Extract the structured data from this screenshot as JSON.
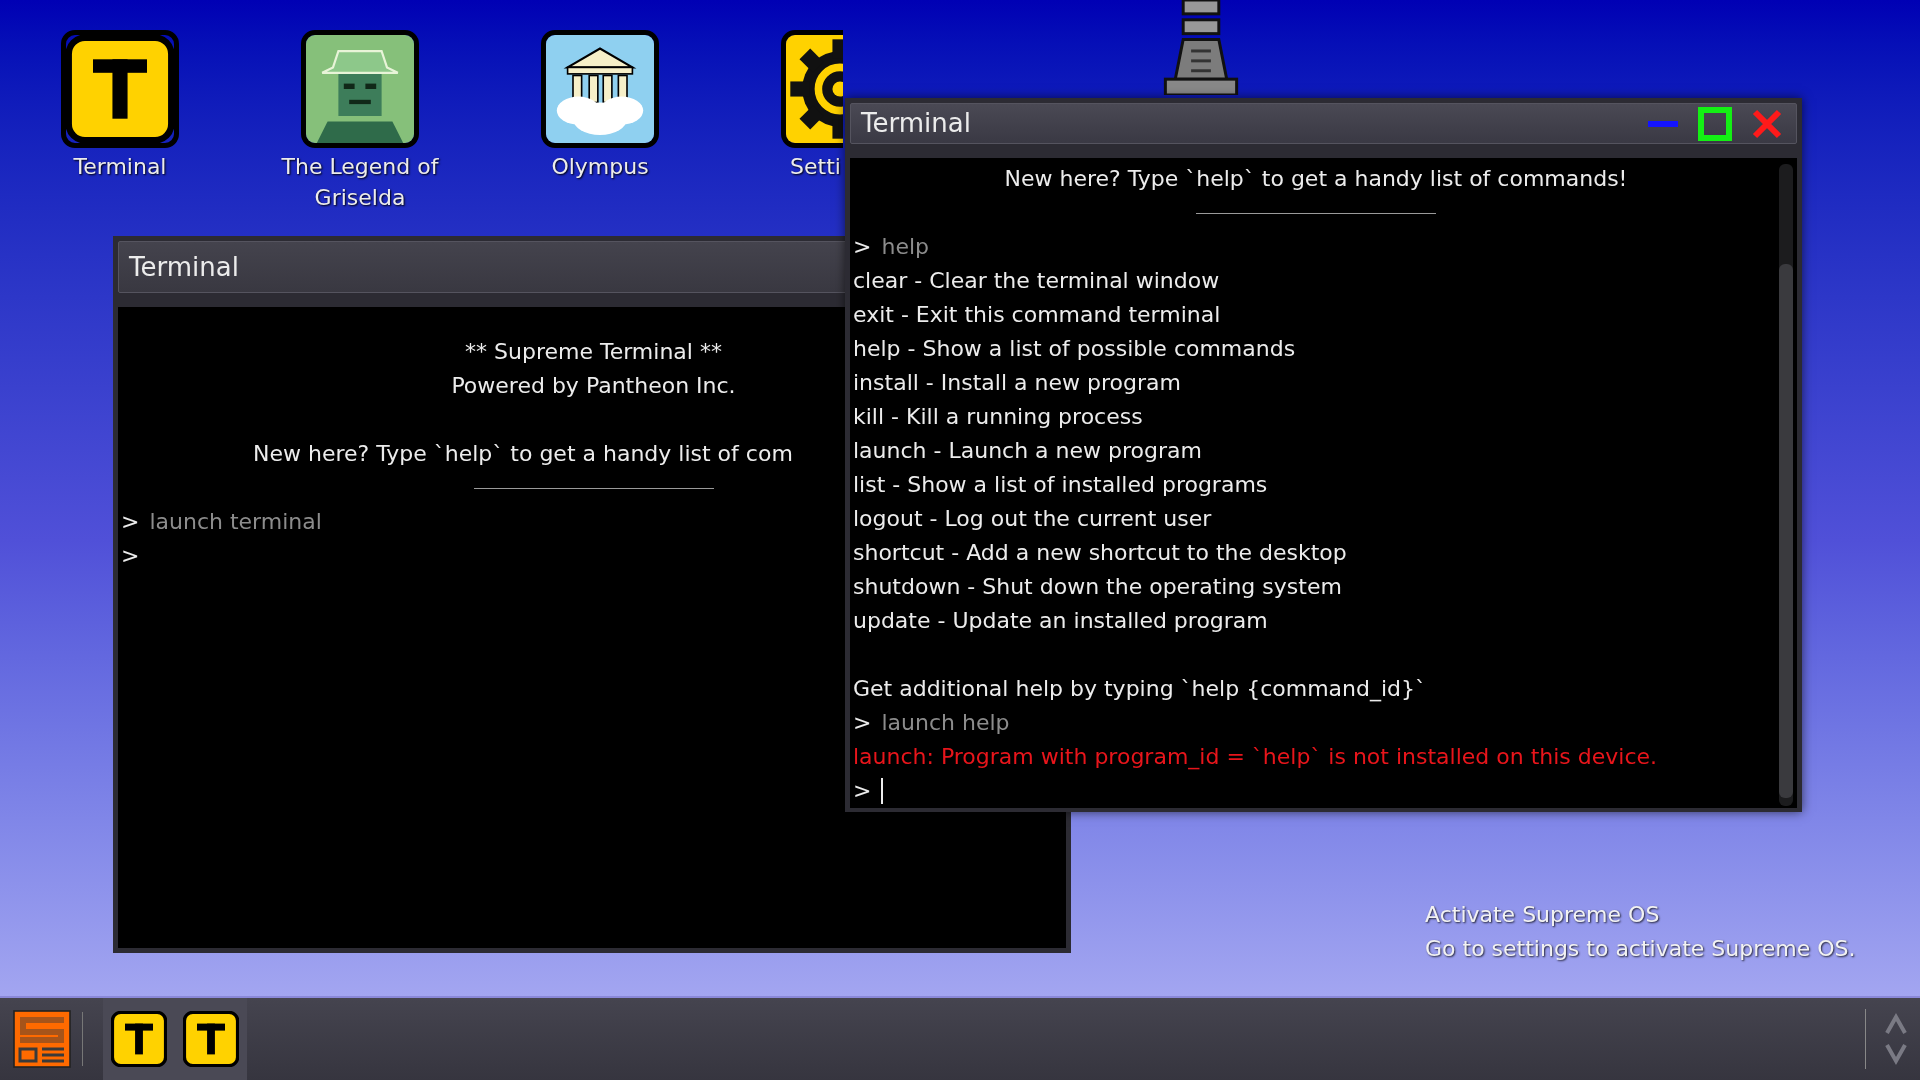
{
  "desktop_icons": [
    {
      "kind": "terminal",
      "label": "Terminal",
      "cut_off": false
    },
    {
      "kind": "game",
      "label": "The Legend of Griselda",
      "cut_off": false
    },
    {
      "kind": "olympus",
      "label": "Olympus",
      "cut_off": false
    },
    {
      "kind": "settings",
      "label": "Setti",
      "cut_off": true
    }
  ],
  "windows": [
    {
      "title": "Terminal",
      "focused": false,
      "lines": [
        {
          "kind": "center",
          "text": "** Supreme Terminal **"
        },
        {
          "kind": "center",
          "text": "Powered by Pantheon Inc."
        },
        {
          "kind": "blank"
        },
        {
          "kind": "clipped",
          "text": "New here? Type `help` to get a handy list of com"
        },
        {
          "kind": "rule"
        },
        {
          "kind": "prompt",
          "prompt": ">",
          "text": "launch terminal"
        },
        {
          "kind": "prompt",
          "prompt": ">"
        }
      ]
    },
    {
      "title": "Terminal",
      "focused": true,
      "has_controls": true,
      "lines": [
        {
          "kind": "center",
          "text": "New here? Type `help` to get a handy list of commands!"
        },
        {
          "kind": "rule"
        },
        {
          "kind": "prompt",
          "prompt": ">",
          "text": "help"
        },
        {
          "kind": "output",
          "text": "clear - Clear the terminal window"
        },
        {
          "kind": "output",
          "text": "exit - Exit this command terminal"
        },
        {
          "kind": "output",
          "text": "help - Show a list of possible commands"
        },
        {
          "kind": "output",
          "text": "install - Install a new program"
        },
        {
          "kind": "output",
          "text": "kill - Kill a running process"
        },
        {
          "kind": "output",
          "text": "launch - Launch a new program"
        },
        {
          "kind": "output",
          "text": "list - Show a list of installed programs"
        },
        {
          "kind": "output",
          "text": "logout - Log out the current user"
        },
        {
          "kind": "output",
          "text": "shortcut - Add a new shortcut to the desktop"
        },
        {
          "kind": "output",
          "text": "shutdown - Shut down the operating system"
        },
        {
          "kind": "output",
          "text": "update - Update an installed program"
        },
        {
          "kind": "blank"
        },
        {
          "kind": "output",
          "text": "Get additional help by typing `help {command_id}`"
        },
        {
          "kind": "prompt",
          "prompt": ">",
          "text": "launch help"
        },
        {
          "kind": "error",
          "text": "launch: Program with program_id = `help` is not installed on this device."
        },
        {
          "kind": "input",
          "prompt": ">"
        }
      ]
    }
  ],
  "activation_notice": [
    "Activate Supreme OS",
    "Go to settings to activate Supreme OS."
  ],
  "taskbar": {
    "apps": [
      {
        "kind": "terminal"
      },
      {
        "kind": "terminal"
      }
    ]
  }
}
